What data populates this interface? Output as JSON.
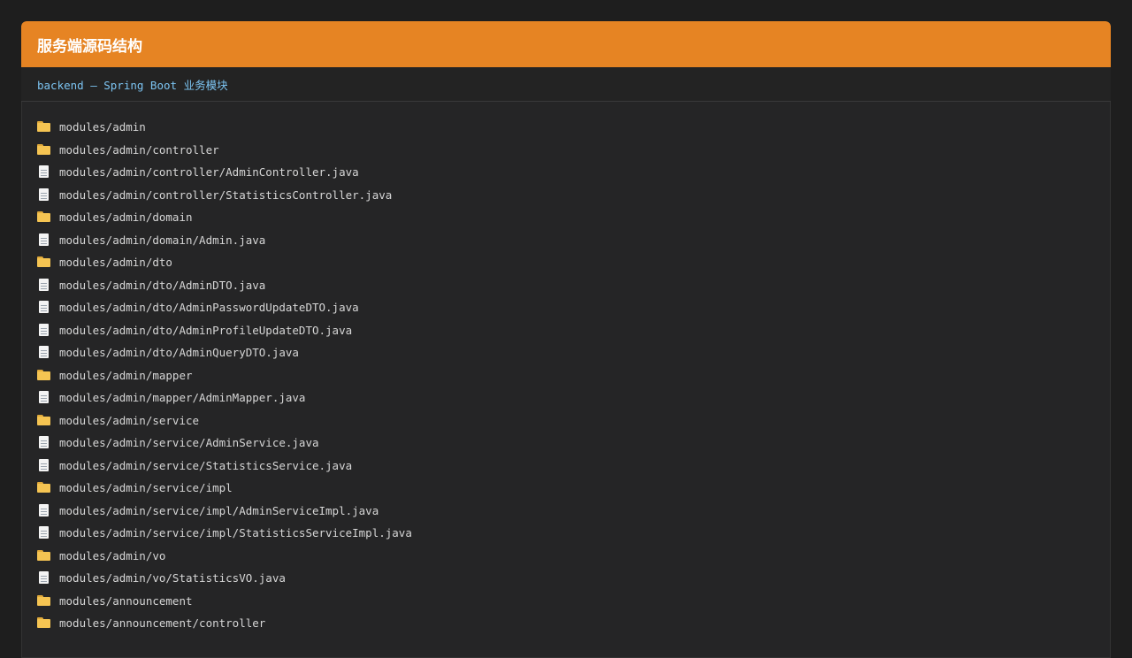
{
  "panel": {
    "title": "服务端源码结构",
    "subtitle": "backend — Spring Boot 业务模块",
    "header_color": "#e68423"
  },
  "tree": [
    {
      "type": "folder",
      "icon": "folder-icon",
      "path": "modules/admin"
    },
    {
      "type": "folder",
      "icon": "folder-icon",
      "path": "modules/admin/controller"
    },
    {
      "type": "file",
      "icon": "file-icon",
      "path": "modules/admin/controller/AdminController.java"
    },
    {
      "type": "file",
      "icon": "file-icon",
      "path": "modules/admin/controller/StatisticsController.java"
    },
    {
      "type": "folder",
      "icon": "folder-icon",
      "path": "modules/admin/domain"
    },
    {
      "type": "file",
      "icon": "file-icon",
      "path": "modules/admin/domain/Admin.java"
    },
    {
      "type": "folder",
      "icon": "folder-icon",
      "path": "modules/admin/dto"
    },
    {
      "type": "file",
      "icon": "file-icon",
      "path": "modules/admin/dto/AdminDTO.java"
    },
    {
      "type": "file",
      "icon": "file-icon",
      "path": "modules/admin/dto/AdminPasswordUpdateDTO.java"
    },
    {
      "type": "file",
      "icon": "file-icon",
      "path": "modules/admin/dto/AdminProfileUpdateDTO.java"
    },
    {
      "type": "file",
      "icon": "file-icon",
      "path": "modules/admin/dto/AdminQueryDTO.java"
    },
    {
      "type": "folder",
      "icon": "folder-icon",
      "path": "modules/admin/mapper"
    },
    {
      "type": "file",
      "icon": "file-icon",
      "path": "modules/admin/mapper/AdminMapper.java"
    },
    {
      "type": "folder",
      "icon": "folder-icon",
      "path": "modules/admin/service"
    },
    {
      "type": "file",
      "icon": "file-icon",
      "path": "modules/admin/service/AdminService.java"
    },
    {
      "type": "file",
      "icon": "file-icon",
      "path": "modules/admin/service/StatisticsService.java"
    },
    {
      "type": "folder",
      "icon": "folder-icon",
      "path": "modules/admin/service/impl"
    },
    {
      "type": "file",
      "icon": "file-icon",
      "path": "modules/admin/service/impl/AdminServiceImpl.java"
    },
    {
      "type": "file",
      "icon": "file-icon",
      "path": "modules/admin/service/impl/StatisticsServiceImpl.java"
    },
    {
      "type": "folder",
      "icon": "folder-icon",
      "path": "modules/admin/vo"
    },
    {
      "type": "file",
      "icon": "file-icon",
      "path": "modules/admin/vo/StatisticsVO.java"
    },
    {
      "type": "folder",
      "icon": "folder-icon",
      "path": "modules/announcement"
    },
    {
      "type": "folder",
      "icon": "folder-icon",
      "path": "modules/announcement/controller"
    }
  ]
}
